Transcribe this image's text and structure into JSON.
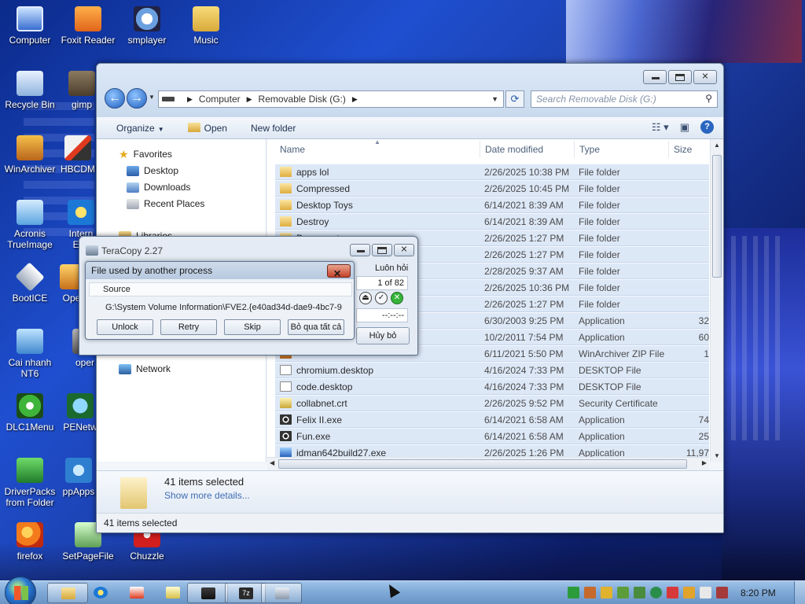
{
  "desktop": {
    "icons": [
      {
        "label": "Computer",
        "icon": "computer-icon"
      },
      {
        "label": "Foxit Reader",
        "icon": "pdf-icon"
      },
      {
        "label": "smplayer",
        "icon": "media-player-icon"
      },
      {
        "label": "Music",
        "icon": "folder-icon"
      },
      {
        "label": "Recycle Bin",
        "icon": "recycle-bin-icon"
      },
      {
        "label": "gimp",
        "icon": "gimp-icon"
      },
      {
        "label": "WinArchiver",
        "icon": "archive-icon"
      },
      {
        "label": "HBCDM",
        "icon": "tools-icon"
      },
      {
        "label": "Acronis TrueImage",
        "icon": "backup-icon"
      },
      {
        "label": "Intern Exp",
        "icon": "ie-icon"
      },
      {
        "label": "BootICE",
        "icon": "bootice-icon"
      },
      {
        "label": "Ope",
        "icon": "app-icon"
      },
      {
        "label": "Cai nhanh NT6",
        "icon": "installer-icon"
      },
      {
        "label": "oper",
        "icon": "app-icon"
      },
      {
        "label": "DLC1Menu",
        "icon": "dlc-icon"
      },
      {
        "label": "PENetw",
        "icon": "network-icon"
      },
      {
        "label": "DriverPacks from Folder",
        "icon": "driver-icon"
      },
      {
        "label": "ppApps",
        "icon": "apps-icon"
      },
      {
        "label": "firefox",
        "icon": "firefox-icon"
      },
      {
        "label": "SetPageFile",
        "icon": "pagefile-icon"
      },
      {
        "label": "Chuzzle",
        "icon": "game-icon"
      }
    ]
  },
  "explorer": {
    "address": {
      "root": "Computer",
      "drive": "Removable Disk (G:)"
    },
    "search_placeholder": "Search Removable Disk (G:)",
    "toolbar": {
      "organize": "Organize",
      "open": "Open",
      "new_folder": "New folder"
    },
    "nav": {
      "favorites": "Favorites",
      "desktop": "Desktop",
      "downloads": "Downloads",
      "recent": "Recent Places",
      "libraries": "Libraries",
      "network": "Network"
    },
    "columns": {
      "name": "Name",
      "date": "Date modified",
      "type": "Type",
      "size": "Size"
    },
    "files": [
      {
        "name": "apps lol",
        "date": "2/26/2025 10:38 PM",
        "type": "File folder",
        "size": "",
        "icon": "folder"
      },
      {
        "name": "Compressed",
        "date": "2/26/2025 10:45 PM",
        "type": "File folder",
        "size": "",
        "icon": "folder"
      },
      {
        "name": "Desktop Toys",
        "date": "6/14/2021 8:39 AM",
        "type": "File folder",
        "size": "",
        "icon": "folder"
      },
      {
        "name": "Destroy",
        "date": "6/14/2021 8:39 AM",
        "type": "File folder",
        "size": "",
        "icon": "folder"
      },
      {
        "name": "Documents",
        "date": "2/26/2025 1:27 PM",
        "type": "File folder",
        "size": "",
        "icon": "folder"
      },
      {
        "name": "",
        "date": "2/26/2025 1:27 PM",
        "type": "File folder",
        "size": "",
        "icon": "folder"
      },
      {
        "name": "",
        "date": "2/28/2025 9:37 AM",
        "type": "File folder",
        "size": "",
        "icon": "folder"
      },
      {
        "name": "",
        "date": "2/26/2025 10:36 PM",
        "type": "File folder",
        "size": "",
        "icon": "folder"
      },
      {
        "name": "",
        "date": "2/26/2025 1:27 PM",
        "type": "File folder",
        "size": "",
        "icon": "folder"
      },
      {
        "name": "",
        "date": "6/30/2003 9:25 PM",
        "type": "Application",
        "size": "32",
        "icon": "app"
      },
      {
        "name": "",
        "date": "10/2/2011 7:54 PM",
        "type": "Application",
        "size": "60",
        "icon": "app"
      },
      {
        "name": "",
        "date": "6/11/2021 5:50 PM",
        "type": "WinArchiver ZIP File",
        "size": "1",
        "icon": "zip"
      },
      {
        "name": "chromium.desktop",
        "date": "4/16/2024 7:33 PM",
        "type": "DESKTOP File",
        "size": "",
        "icon": "file"
      },
      {
        "name": "code.desktop",
        "date": "4/16/2024 7:33 PM",
        "type": "DESKTOP File",
        "size": "",
        "icon": "file"
      },
      {
        "name": "collabnet.crt",
        "date": "2/26/2025 9:52 PM",
        "type": "Security Certificate",
        "size": "",
        "icon": "cert"
      },
      {
        "name": "Felix II.exe",
        "date": "6/14/2021 6:58 AM",
        "type": "Application",
        "size": "74",
        "icon": "app"
      },
      {
        "name": "Fun.exe",
        "date": "6/14/2021 6:58 AM",
        "type": "Application",
        "size": "25",
        "icon": "app"
      },
      {
        "name": "idman642build27.exe",
        "date": "2/26/2025 1:26 PM",
        "type": "Application",
        "size": "11,97",
        "icon": "idm"
      }
    ],
    "details": {
      "selected": "41 items selected",
      "more": "Show more details..."
    },
    "status": "41 items selected"
  },
  "teracopy": {
    "title": "TeraCopy 2.27",
    "close_when_done": "Luôn hỏi",
    "counter": "1 of 82",
    "time": "--:--:--",
    "cancel": "Hủy bỏ"
  },
  "dialog": {
    "title": "File used by another process",
    "source_label": "Source",
    "source_path": "G:\\System Volume Information\\FVE2.{e40ad34d-dae9-4bc7-9",
    "buttons": {
      "unlock": "Unlock",
      "retry": "Retry",
      "skip": "Skip",
      "skip_all": "Bỏ qua tất cả"
    }
  },
  "taskbar": {
    "clock": "8:20 PM",
    "seven_zip": "7z"
  }
}
